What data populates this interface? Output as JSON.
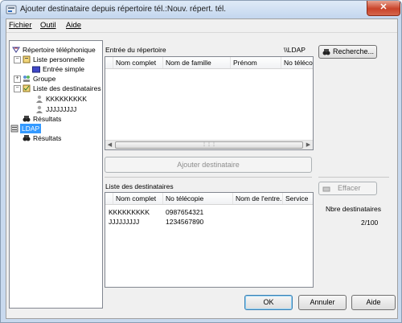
{
  "window": {
    "title": "Ajouter destinataire depuis répertoire tél.:Nouv. répert. tél.",
    "close_glyph": "✕"
  },
  "menubar": {
    "items": [
      "Fichier",
      "Outil",
      "Aide"
    ]
  },
  "tree": {
    "nodes": [
      {
        "label": "Répertoire téléphonique",
        "icon": "phonebook-icon"
      },
      {
        "label": "Liste personnelle",
        "icon": "personal-list-icon"
      },
      {
        "label": "Entrée simple",
        "icon": "folder-icon"
      },
      {
        "label": "Groupe",
        "icon": "group-icon"
      },
      {
        "label": "Liste des destinataires",
        "icon": "recipient-list-icon"
      },
      {
        "label": "KKKKKKKKK",
        "icon": "person-icon"
      },
      {
        "label": "JJJJJJJJJ",
        "icon": "person-icon"
      },
      {
        "label": "Résultats",
        "icon": "binoculars-icon"
      },
      {
        "label": "LDAP",
        "icon": "server-icon"
      },
      {
        "label": "Résultats",
        "icon": "binoculars-icon"
      }
    ]
  },
  "entry": {
    "label": "Entrée du répertoire",
    "source": "\\\\LDAP",
    "columns": [
      "Nom complet",
      "Nom de famille",
      "Prénom",
      "No télécopie"
    ]
  },
  "search_button": {
    "label": "Recherche..."
  },
  "add_button": {
    "label": "Ajouter destinataire"
  },
  "recipients": {
    "label": "Liste des destinataires",
    "columns": [
      "Nom complet",
      "No télécopie",
      "Nom de l'entre...",
      "Service"
    ],
    "rows": [
      {
        "name": "KKKKKKKKK",
        "fax": "0987654321"
      },
      {
        "name": "JJJJJJJJJ",
        "fax": "1234567890"
      }
    ]
  },
  "clear_button": {
    "label": "Effacer"
  },
  "count": {
    "label": "Nbre destinataires",
    "value": "2/100"
  },
  "footer": {
    "ok": "OK",
    "cancel": "Annuler",
    "help": "Aide"
  },
  "scroll": {
    "left_arrow": "◀",
    "right_arrow": "▶",
    "grip": "⋮⋮⋮"
  }
}
